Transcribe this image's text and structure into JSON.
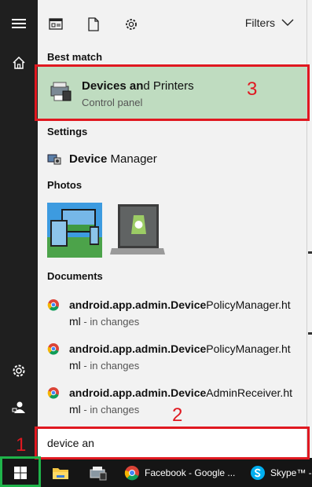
{
  "toolbar": {
    "filters_label": "Filters"
  },
  "sections": {
    "best_match": "Best match",
    "settings": "Settings",
    "photos": "Photos",
    "documents": "Documents"
  },
  "best_match": {
    "title_prefix": "Devices an",
    "title_suffix": "d Printers",
    "subtitle": "Control panel"
  },
  "settings": {
    "item_bold": "Device",
    "item_rest": " Manager"
  },
  "documents": [
    {
      "bold1": "android.app.admin.",
      "bold2": "Device",
      "rest": "PolicyManager.ht",
      "line2": "ml",
      "sep": " - ",
      "location": "in changes"
    },
    {
      "bold1": "android.app.admin.",
      "bold2": "Device",
      "rest": "PolicyManager.ht",
      "line2": "ml",
      "sep": " - ",
      "location": "in changes"
    },
    {
      "bold1": "android.app.admin.",
      "bold2": "Device",
      "rest": "AdminReceiver.ht",
      "line2": "ml",
      "sep": " - ",
      "location": "in changes"
    }
  ],
  "search": {
    "query": "device an"
  },
  "taskbar": {
    "facebook": "Facebook - Google ...",
    "skype": "Skype™ -"
  },
  "annotations": {
    "n1": "1",
    "n2": "2",
    "n3": "3"
  },
  "colors": {
    "accent_green": "#bfdcc0",
    "annotation_red": "#e01820",
    "annotation_green": "#1fb34a"
  }
}
